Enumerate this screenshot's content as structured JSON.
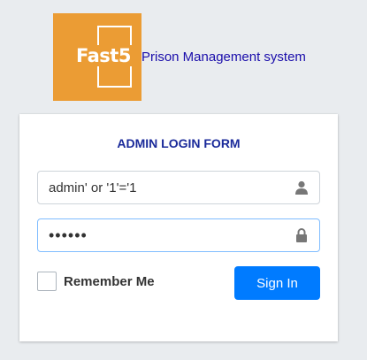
{
  "header": {
    "logo_text": "Fast5",
    "brand_link": "Prison Management system"
  },
  "login_form": {
    "title": "ADMIN LOGIN FORM",
    "username_value": "admin' or '1'='1",
    "password_value": "aaaaaa",
    "remember_label": "Remember Me",
    "sign_in_label": "Sign In"
  },
  "icons": {
    "username": "user-icon",
    "password": "lock-icon"
  },
  "colors": {
    "logo_bg": "#eb9c34",
    "brand_link": "#1a0dab",
    "title": "#1a2a9a",
    "primary_button": "#007bff",
    "focus_border": "#80bdff"
  }
}
